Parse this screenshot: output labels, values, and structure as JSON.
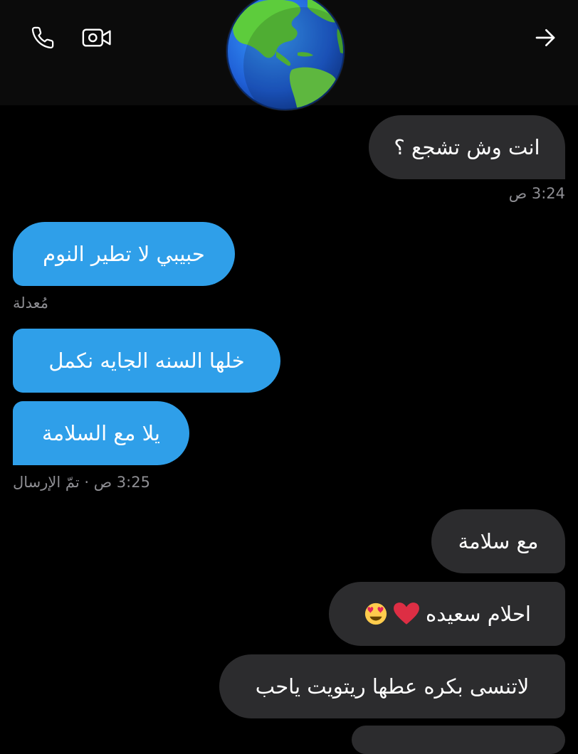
{
  "header": {
    "call_icon": "phone-icon",
    "video_icon": "video-camera-icon",
    "back_icon": "arrow-right-icon",
    "avatar": "globe-americas-emoji"
  },
  "messages": [
    {
      "side": "received",
      "text": "انت وش تشجع ؟"
    },
    {
      "meta": "3:24 ص"
    },
    {
      "side": "sent",
      "text": "حبيبي لا تطير النوم"
    },
    {
      "meta": "مُعدلة"
    },
    {
      "side": "sent",
      "text": "خلها السنه الجايه نكمل"
    },
    {
      "side": "sent",
      "text": "يلا مع السلامة"
    },
    {
      "meta": "3:25 ص · تمّ الإرسال"
    },
    {
      "side": "received",
      "text": "مع سلامة"
    },
    {
      "side": "received",
      "text": "احلام سعيده",
      "emojis": [
        "smiling-face-with-heart-eyes-emoji",
        "red-heart-emoji"
      ]
    },
    {
      "side": "received",
      "text": "لاتنسى بكره عطها ريتويت ياحب"
    }
  ],
  "colors": {
    "background": "#000000",
    "sent_bubble": "#2f9fe9",
    "received_bubble": "#2c2c2e",
    "meta_text": "#8e8e93"
  }
}
